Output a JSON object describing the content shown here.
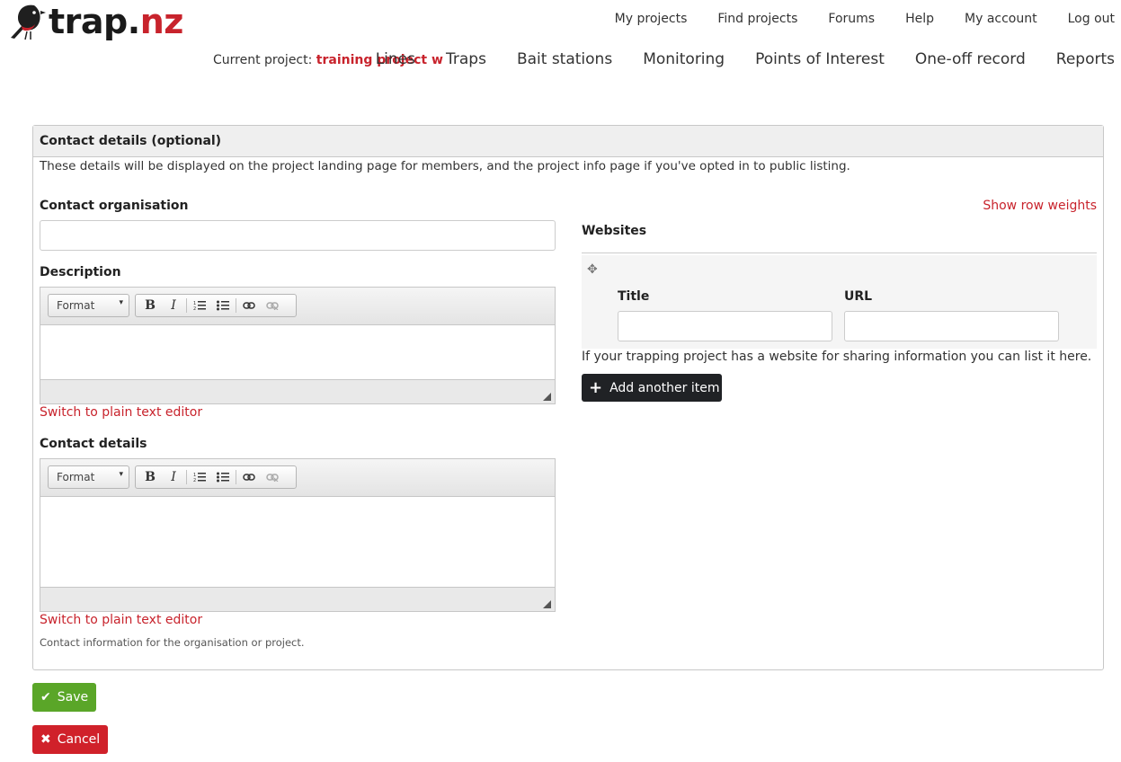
{
  "brand": {
    "name_main": "trap.",
    "name_accent": "nz"
  },
  "colors": {
    "accent": "#c8232c",
    "save": "#5aa628",
    "cancel": "#d0212a",
    "dark_button": "#202225"
  },
  "top_nav": [
    "My projects",
    "Find projects",
    "Forums",
    "Help",
    "My account",
    "Log out"
  ],
  "current_project": {
    "label": "Current project: ",
    "name": "training project w"
  },
  "main_nav": [
    "Lines",
    "Traps",
    "Bait stations",
    "Monitoring",
    "Points of Interest",
    "One-off record",
    "Reports"
  ],
  "panel": {
    "title": "Contact details (optional)",
    "description": "These details will be displayed on the project landing page for members, and the project info page if you've opted in to public listing."
  },
  "form": {
    "contact_org_label": "Contact organisation",
    "contact_org_value": "",
    "description_label": "Description",
    "contact_details_label": "Contact details",
    "switch_editor": "Switch to plain text editor",
    "contact_help": "Contact information for the organisation or project."
  },
  "editor_toolbar": {
    "format": "Format",
    "bold": "B",
    "italic": "I"
  },
  "websites": {
    "label": "Websites",
    "show_row_weights": "Show row weights",
    "title_label": "Title",
    "url_label": "URL",
    "title_value": "",
    "url_value": "",
    "note": "If your trapping project has a website for sharing information you can list it here.",
    "add_button": "Add another item"
  },
  "actions": {
    "save": "Save",
    "cancel": "Cancel"
  }
}
